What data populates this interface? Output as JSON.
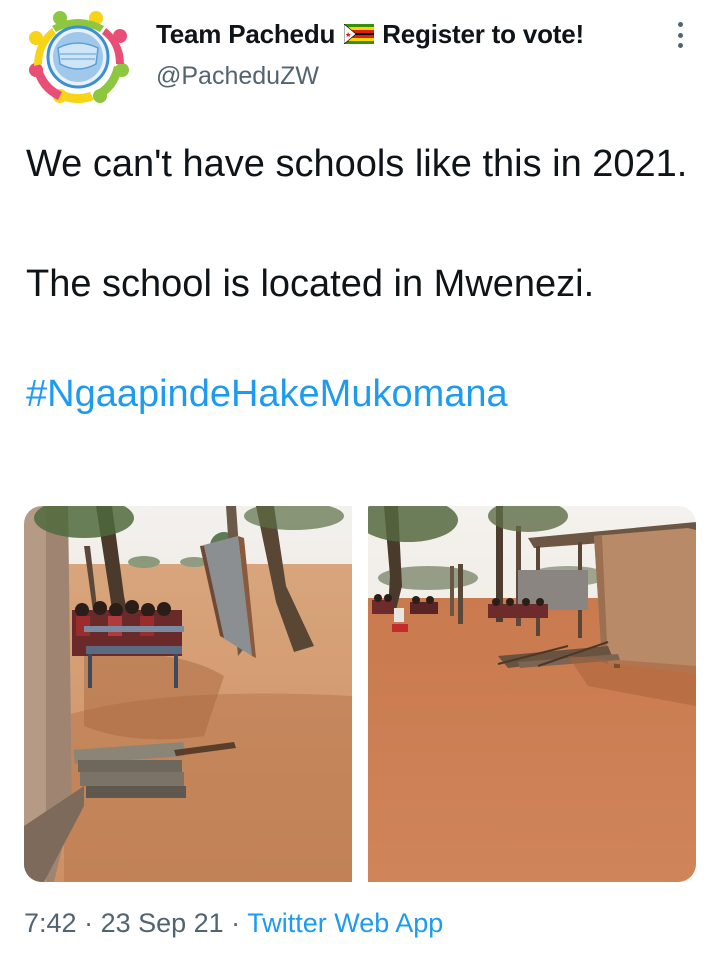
{
  "author": {
    "display_name_part1": "Team Pachedu",
    "flag_icon": "zimbabwe-flag-icon",
    "display_name_part2": "Register to vote!",
    "handle": "@PacheduZW",
    "avatar_icon": "team-pachedu-logo"
  },
  "tweet": {
    "line1": "We can't have schools like this in 2021.",
    "line2": "The school is located in Mwenezi.",
    "hashtag": "#NgaapindeHakeMukomana"
  },
  "media": {
    "photo_count": 2
  },
  "meta": {
    "time": "7:42",
    "separator1": " · ",
    "date": "23 Sep 21",
    "separator2": " · ",
    "source": "Twitter Web App"
  },
  "colors": {
    "link": "#1d9bf0",
    "secondary_text": "#536471",
    "primary_text": "#0f1419"
  }
}
